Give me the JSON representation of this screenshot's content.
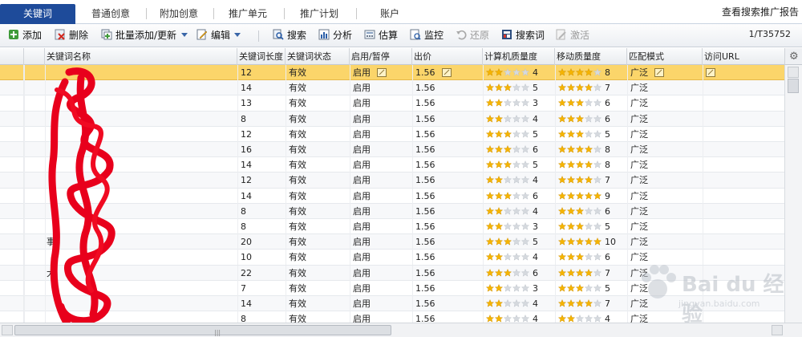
{
  "tabs": [
    {
      "label": "关键词",
      "active": true
    },
    {
      "label": "普通创意",
      "active": false
    },
    {
      "label": "附加创意",
      "active": false
    },
    {
      "label": "推广单元",
      "active": false
    },
    {
      "label": "推广计划",
      "active": false
    },
    {
      "label": "账户",
      "active": false
    }
  ],
  "report_link": "查看搜索推广报告",
  "toolbar": {
    "add": "添加",
    "delete": "删除",
    "batch_add": "批量添加/更新",
    "edit": "编辑",
    "search": "搜索",
    "analyze": "分析",
    "estimate": "估算",
    "monitor": "监控",
    "restore": "还原",
    "search_terms": "搜索词",
    "activate": "激活"
  },
  "page_count": "1/T35752",
  "columns": {
    "name": "关键词名称",
    "length": "关键词长度",
    "status": "关键词状态",
    "enable": "启用/暂停",
    "bid": "出价",
    "pc_quality": "计算机质量度",
    "mobile_quality": "移动质量度",
    "match": "匹配模式",
    "url": "访问URL"
  },
  "rows": [
    {
      "name": "",
      "length": "12",
      "status": "有效",
      "enable": "启用",
      "bid": "1.56",
      "pc": 4,
      "mobile": 8,
      "match": "广泛",
      "selected": true
    },
    {
      "name": "",
      "length": "14",
      "status": "有效",
      "enable": "启用",
      "bid": "1.56",
      "pc": 5,
      "mobile": 7,
      "match": "广泛"
    },
    {
      "name": "",
      "length": "13",
      "status": "有效",
      "enable": "启用",
      "bid": "1.56",
      "pc": 3,
      "mobile": 6,
      "match": "广泛"
    },
    {
      "name": "",
      "length": "8",
      "status": "有效",
      "enable": "启用",
      "bid": "1.56",
      "pc": 4,
      "mobile": 6,
      "match": "广泛"
    },
    {
      "name": "",
      "length": "12",
      "status": "有效",
      "enable": "启用",
      "bid": "1.56",
      "pc": 5,
      "mobile": 5,
      "match": "广泛"
    },
    {
      "name": "",
      "length": "16",
      "status": "有效",
      "enable": "启用",
      "bid": "1.56",
      "pc": 6,
      "mobile": 8,
      "match": "广泛"
    },
    {
      "name": "",
      "length": "14",
      "status": "有效",
      "enable": "启用",
      "bid": "1.56",
      "pc": 5,
      "mobile": 8,
      "match": "广泛"
    },
    {
      "name": "",
      "length": "12",
      "status": "有效",
      "enable": "启用",
      "bid": "1.56",
      "pc": 4,
      "mobile": 7,
      "match": "广泛"
    },
    {
      "name": "",
      "length": "14",
      "status": "有效",
      "enable": "启用",
      "bid": "1.56",
      "pc": 6,
      "mobile": 9,
      "match": "广泛"
    },
    {
      "name": "",
      "length": "8",
      "status": "有效",
      "enable": "启用",
      "bid": "1.56",
      "pc": 4,
      "mobile": 6,
      "match": "广泛"
    },
    {
      "name": "",
      "length": "8",
      "status": "有效",
      "enable": "启用",
      "bid": "1.56",
      "pc": 3,
      "mobile": 5,
      "match": "广泛"
    },
    {
      "name": "事",
      "length": "20",
      "status": "有效",
      "enable": "启用",
      "bid": "1.56",
      "pc": 5,
      "mobile": 10,
      "match": "广泛"
    },
    {
      "name": "",
      "length": "10",
      "status": "有效",
      "enable": "启用",
      "bid": "1.56",
      "pc": 4,
      "mobile": 6,
      "match": "广泛"
    },
    {
      "name": "大",
      "length": "22",
      "status": "有效",
      "enable": "启用",
      "bid": "1.56",
      "pc": 6,
      "mobile": 7,
      "match": "广泛"
    },
    {
      "name": "",
      "length": "7",
      "status": "有效",
      "enable": "启用",
      "bid": "1.56",
      "pc": 3,
      "mobile": 5,
      "match": "广泛"
    },
    {
      "name": "",
      "length": "14",
      "status": "有效",
      "enable": "启用",
      "bid": "1.56",
      "pc": 4,
      "mobile": 7,
      "match": "广泛"
    },
    {
      "name": "",
      "length": "8",
      "status": "有效",
      "enable": "启用",
      "bid": "1.56",
      "pc": 4,
      "mobile": 4,
      "match": "广泛"
    }
  ],
  "watermark": {
    "text": "Bai du 经验",
    "sub": "jingyan.baidu.com"
  },
  "colors": {
    "accent": "#1e4b9a",
    "selected_row": "#fbd56a",
    "star_on": "#f5b400",
    "star_off": "#d5d9de",
    "redaction": "#e8001c"
  },
  "icons": {
    "add": "add-icon",
    "delete": "delete-icon",
    "batch": "batch-icon",
    "edit": "edit-icon",
    "search": "search-icon",
    "analyze": "analyze-icon",
    "estimate": "estimate-icon",
    "monitor": "monitor-icon",
    "restore": "restore-icon",
    "terms": "search-terms-icon",
    "activate": "activate-icon"
  }
}
